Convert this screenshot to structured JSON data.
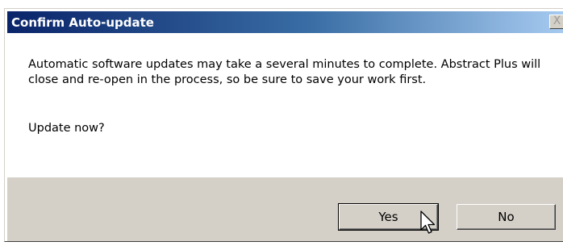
{
  "dialog": {
    "title": "Confirm Auto-update",
    "close_label": "X",
    "message": "Automatic software updates may take a several minutes to complete. Abstract Plus will close and re-open in the process, so be sure to save your work first.",
    "question": "Update now?",
    "yes_label": "Yes",
    "no_label": "No"
  },
  "colors": {
    "title_gradient_start": "#0a246a",
    "title_gradient_end": "#a6caf0",
    "face": "#d4d0c8"
  },
  "icons": {
    "close": "close-icon",
    "cursor": "mouse-pointer-icon"
  }
}
